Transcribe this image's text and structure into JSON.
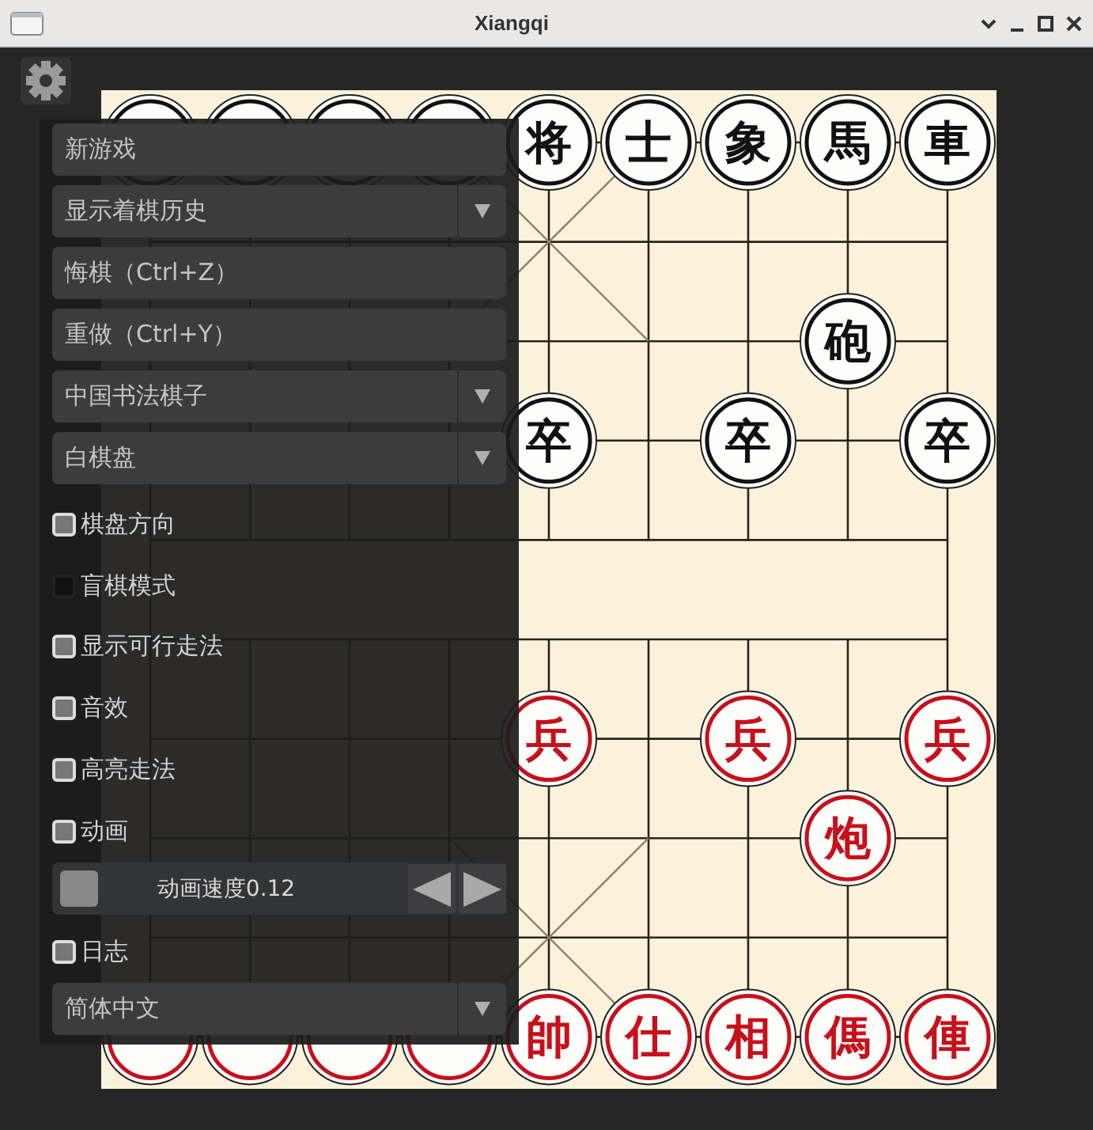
{
  "window": {
    "title": "Xiangqi"
  },
  "board": {
    "rows": [
      [
        {
          "color": "#111111"
        },
        {
          "color": "#111111"
        },
        {
          "color": "#111111"
        },
        {
          "color": "#111111"
        },
        {
          "char": "将",
          "color": "#111111"
        },
        {
          "char": "士",
          "color": "#111111"
        },
        {
          "char": "象",
          "color": "#111111"
        },
        {
          "char": "馬",
          "color": "#111111"
        },
        {
          "char": "車",
          "color": "#111111"
        }
      ],
      [
        null,
        null,
        null,
        null,
        null,
        null,
        null,
        null,
        null
      ],
      [
        null,
        null,
        null,
        null,
        null,
        null,
        null,
        {
          "char": "砲",
          "color": "#111111"
        },
        null
      ],
      [
        null,
        null,
        null,
        null,
        {
          "char": "卒",
          "color": "#111111"
        },
        null,
        {
          "char": "卒",
          "color": "#111111"
        },
        null,
        {
          "char": "卒",
          "color": "#111111"
        }
      ],
      [
        null,
        null,
        null,
        null,
        null,
        null,
        null,
        null,
        null
      ],
      [
        null,
        null,
        null,
        null,
        null,
        null,
        null,
        null,
        null
      ],
      [
        null,
        null,
        null,
        null,
        {
          "char": "兵",
          "color": "#c8101a"
        },
        null,
        {
          "char": "兵",
          "color": "#c8101a"
        },
        null,
        {
          "char": "兵",
          "color": "#c8101a"
        }
      ],
      [
        null,
        null,
        null,
        null,
        null,
        null,
        null,
        {
          "char": "炮",
          "color": "#c8101a"
        },
        null
      ],
      [
        null,
        null,
        null,
        null,
        null,
        null,
        null,
        null,
        null
      ],
      [
        {
          "color": "#c8101a"
        },
        {
          "color": "#c8101a"
        },
        {
          "color": "#c8101a"
        },
        {
          "color": "#c8101a"
        },
        {
          "char": "帥",
          "color": "#c8101a"
        },
        {
          "char": "仕",
          "color": "#c8101a"
        },
        {
          "char": "相",
          "color": "#c8101a"
        },
        {
          "char": "傌",
          "color": "#c8101a"
        },
        {
          "char": "俥",
          "color": "#c8101a"
        }
      ]
    ]
  },
  "menu": {
    "items": [
      {
        "kind": "button",
        "label": "新游戏"
      },
      {
        "kind": "dropdown",
        "label": "显示着棋历史"
      },
      {
        "kind": "button",
        "label": "悔棋（Ctrl+Z）"
      },
      {
        "kind": "button",
        "label": "重做（Ctrl+Y）"
      },
      {
        "kind": "dropdown",
        "label": "中国书法棋子"
      },
      {
        "kind": "dropdown",
        "label": "白棋盘"
      },
      {
        "kind": "checkbox",
        "label": "棋盘方向",
        "checked": true
      },
      {
        "kind": "checkbox",
        "label": "盲棋模式",
        "checked": false
      },
      {
        "kind": "checkbox",
        "label": "显示可行走法",
        "checked": true
      },
      {
        "kind": "checkbox",
        "label": "音效",
        "checked": true
      },
      {
        "kind": "checkbox",
        "label": "高亮走法",
        "checked": true
      },
      {
        "kind": "checkbox",
        "label": "动画",
        "checked": true
      },
      {
        "kind": "slider",
        "label": "动画速度0.12",
        "level": 0
      },
      {
        "kind": "checkbox",
        "label": "日志",
        "checked": true
      },
      {
        "kind": "dropdown",
        "label": "简体中文"
      }
    ]
  }
}
